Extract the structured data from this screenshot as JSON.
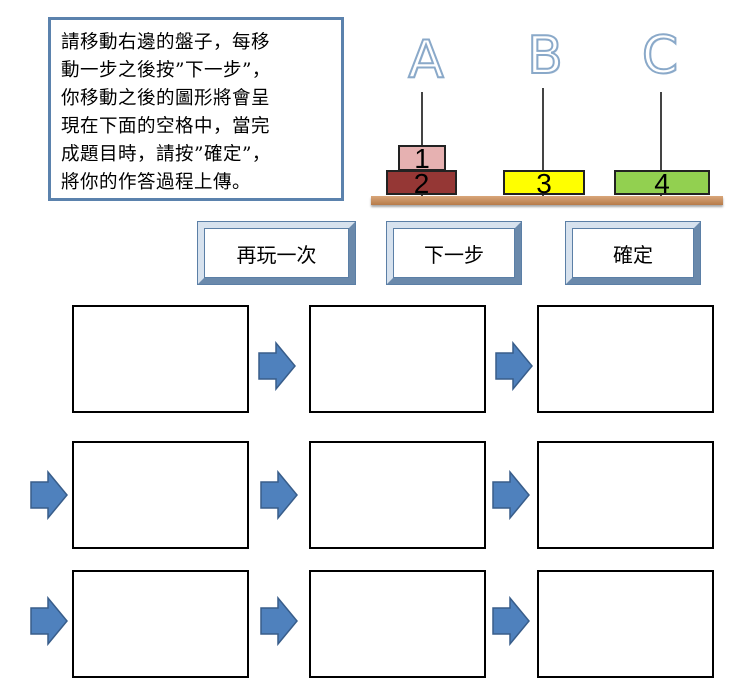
{
  "instructions": {
    "lines": [
      "請移動右邊的盤子，每移",
      "動一步之後按”下一步”，",
      "你移動之後的圖形將會呈",
      "現在下面的空格中，當完",
      "成題目時，請按”確定”，",
      "將你的作答過程上傳。"
    ]
  },
  "pegs": [
    {
      "label": "A"
    },
    {
      "label": "B"
    },
    {
      "label": "C"
    }
  ],
  "disks": [
    {
      "number": "1",
      "peg": "A",
      "color": "#e6b1b1"
    },
    {
      "number": "2",
      "peg": "A",
      "color": "#953735"
    },
    {
      "number": "3",
      "peg": "B",
      "color": "#ffff00"
    },
    {
      "number": "4",
      "peg": "C",
      "color": "#92d050"
    }
  ],
  "buttons": {
    "replay": "再玩一次",
    "next": "下一步",
    "confirm": "確定"
  },
  "colors": {
    "accent": "#4f81bd",
    "box_border": "#5b82ad",
    "board": "#c8905d"
  },
  "step_frames": 9
}
